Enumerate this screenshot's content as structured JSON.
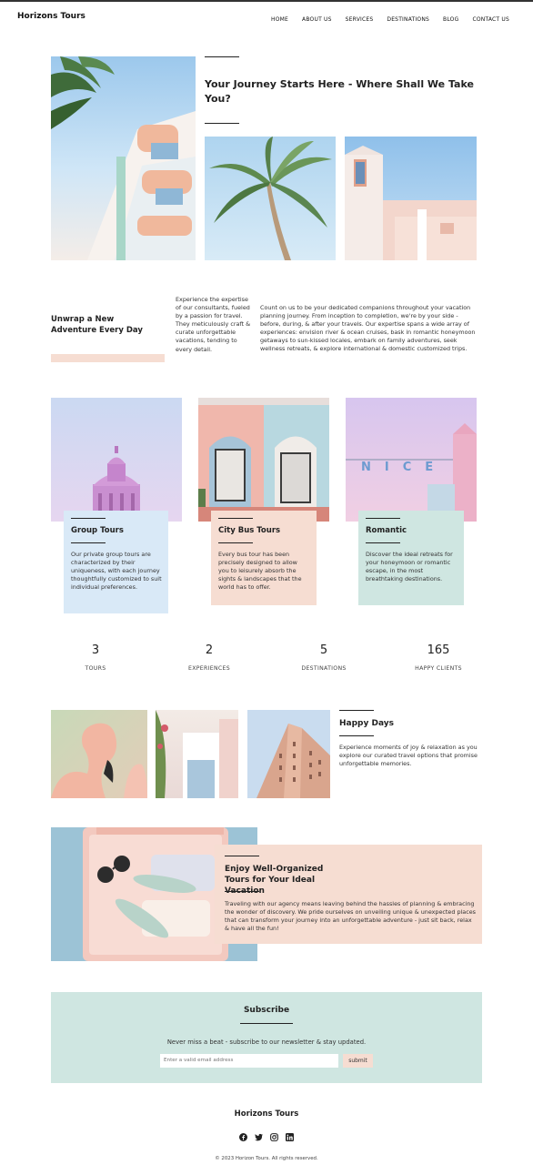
{
  "brand": "Horizons Tours",
  "nav": [
    "HOME",
    "ABOUT US",
    "SERVICES",
    "DESTINATIONS",
    "BLOG",
    "CONTACT US"
  ],
  "hero": {
    "title": "Your Journey Starts Here - Where Shall We Take You?"
  },
  "intro": {
    "heading": "Unwrap a New Adventure Every Day",
    "col1": "Experience the expertise of our consultants, fueled by a passion for travel. They meticulously craft & curate unforgettable vacations, tending to every detail.",
    "col2": "Count on us to be your dedicated companions throughout your vacation planning journey. From inception to completion, we're by your side - before, during, & after your travels. Our expertise spans a wide array of experiences: envision river & ocean cruises, bask in romantic honeymoon getaways to sun-kissed locales, embark on family adventures, seek wellness retreats, & explore international & domestic customized trips."
  },
  "cards": [
    {
      "title": "Group Tours",
      "text": "Our private group tours are characterized by their uniqueness, with each journey thoughtfully customized to suit individual preferences.",
      "color": "#d9e9f7"
    },
    {
      "title": "City Bus Tours",
      "text": "Every bus tour has been precisely designed to allow you to leisurely absorb the sights & landscapes that the world has to offer.",
      "color": "#f6ddd2"
    },
    {
      "title": "Romantic",
      "text": "Discover the ideal retreats for your honeymoon or romantic escape, in the most breathtaking destinations.",
      "color": "#cfe6e1"
    }
  ],
  "nice_sign": "NICE",
  "stats": [
    {
      "num": "3",
      "label": "TOURS"
    },
    {
      "num": "2",
      "label": "EXPERIENCES"
    },
    {
      "num": "5",
      "label": "DESTINATIONS"
    },
    {
      "num": "165",
      "label": "HAPPY CLIENTS"
    }
  ],
  "happy": {
    "title": "Happy Days",
    "text": "Experience moments of joy & relaxation as you explore our curated travel options that promise unforgettable memories."
  },
  "enjoy": {
    "title": "Enjoy Well-Organized Tours for Your Ideal Vacation",
    "text": "Traveling with our agency means leaving behind the hassles of planning & embracing the wonder of discovery. We pride ourselves on unveiling unique & unexpected places that can transform your journey into an unforgettable adventure - just sit back, relax & have all the fun!"
  },
  "subscribe": {
    "title": "Subscribe",
    "text": "Never miss a beat - subscribe to our newsletter & stay updated.",
    "placeholder": "Enter a valid email address",
    "button": "submit"
  },
  "footer": {
    "brand": "Horizons Tours",
    "copyright": "© 2023 Horizon Tours. All rights reserved."
  },
  "colors": {
    "peach": "#f6ddd2",
    "mint": "#cfe6e1",
    "sky": "#d9e9f7"
  }
}
